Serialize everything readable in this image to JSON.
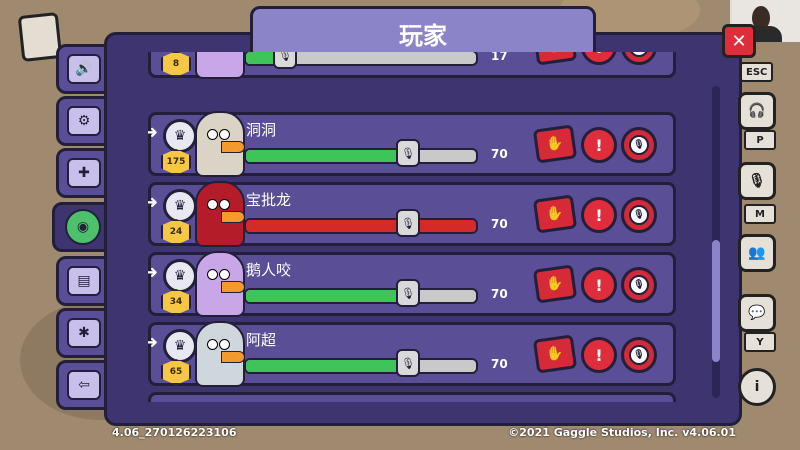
{
  "title": "玩家",
  "partial_top": {
    "level": "8",
    "volume": "17",
    "volume_fraction": 0.14
  },
  "players": [
    {
      "name": "洞洞",
      "level": "175",
      "volume": "70",
      "volume_fraction": 0.7,
      "muted_bar": false,
      "color": "#d9d4c6"
    },
    {
      "name": "宝批龙",
      "level": "24",
      "volume": "70",
      "volume_fraction": 0.7,
      "muted_bar": true,
      "color": "#b51c2a"
    },
    {
      "name": "鹅人咬",
      "level": "34",
      "volume": "70",
      "volume_fraction": 0.7,
      "muted_bar": false,
      "color": "#c9a6e8"
    },
    {
      "name": "阿超",
      "level": "65",
      "volume": "70",
      "volume_fraction": 0.7,
      "muted_bar": false,
      "color": "#cfd6dc"
    }
  ],
  "hotkeys": {
    "esc": "ESC",
    "p": "P",
    "m": "M",
    "y": "Y"
  },
  "footer": {
    "build": "4.06_270126223106",
    "copyright": "©2021 Gaggle Studios, Inc. v4.06.01"
  }
}
